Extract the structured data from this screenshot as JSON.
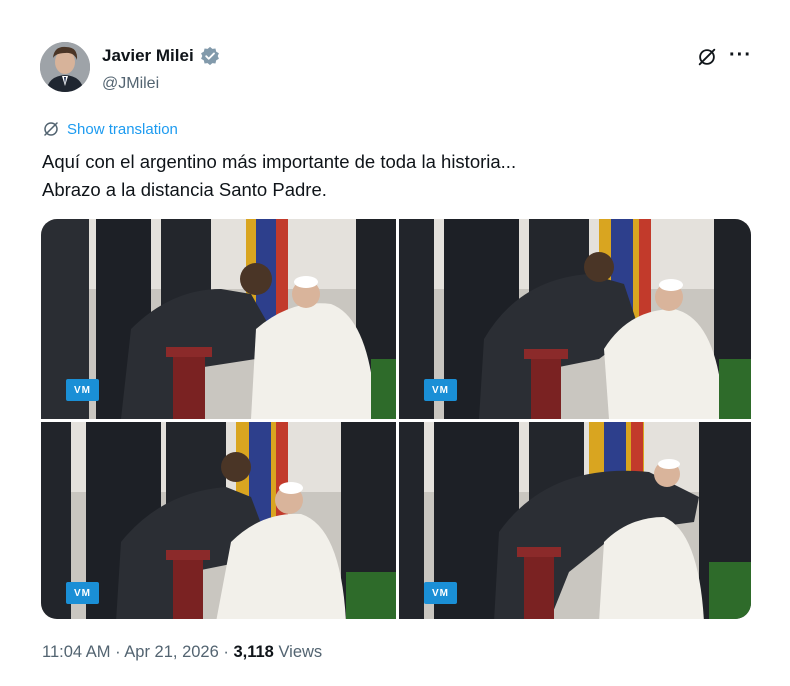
{
  "author": {
    "name": "Javier Milei",
    "handle": "@JMilei",
    "verified": true,
    "avatar_icon": "avatar-photo"
  },
  "header_icons": {
    "grok": "grok-icon",
    "more": "···"
  },
  "translate_label": "Show translation",
  "tweet": {
    "line1": "Aquí con el argentino más importante de toda la historia...",
    "line2": "Abrazo a la distancia Santo Padre."
  },
  "media": {
    "photos": [
      {
        "logo": "vatican-media-logo"
      },
      {
        "logo": "vatican-media-logo"
      },
      {
        "logo": "vatican-media-logo"
      },
      {
        "logo": "vatican-media-logo"
      }
    ]
  },
  "meta": {
    "time": "11:04 AM",
    "sep1": "·",
    "date": "Apr 21, 2026",
    "sep2": "·",
    "views_count": "3,118",
    "views_label": "Views"
  },
  "colors": {
    "link": "#1d9bf0",
    "verified": "#829aab",
    "secondary": "#536471"
  }
}
